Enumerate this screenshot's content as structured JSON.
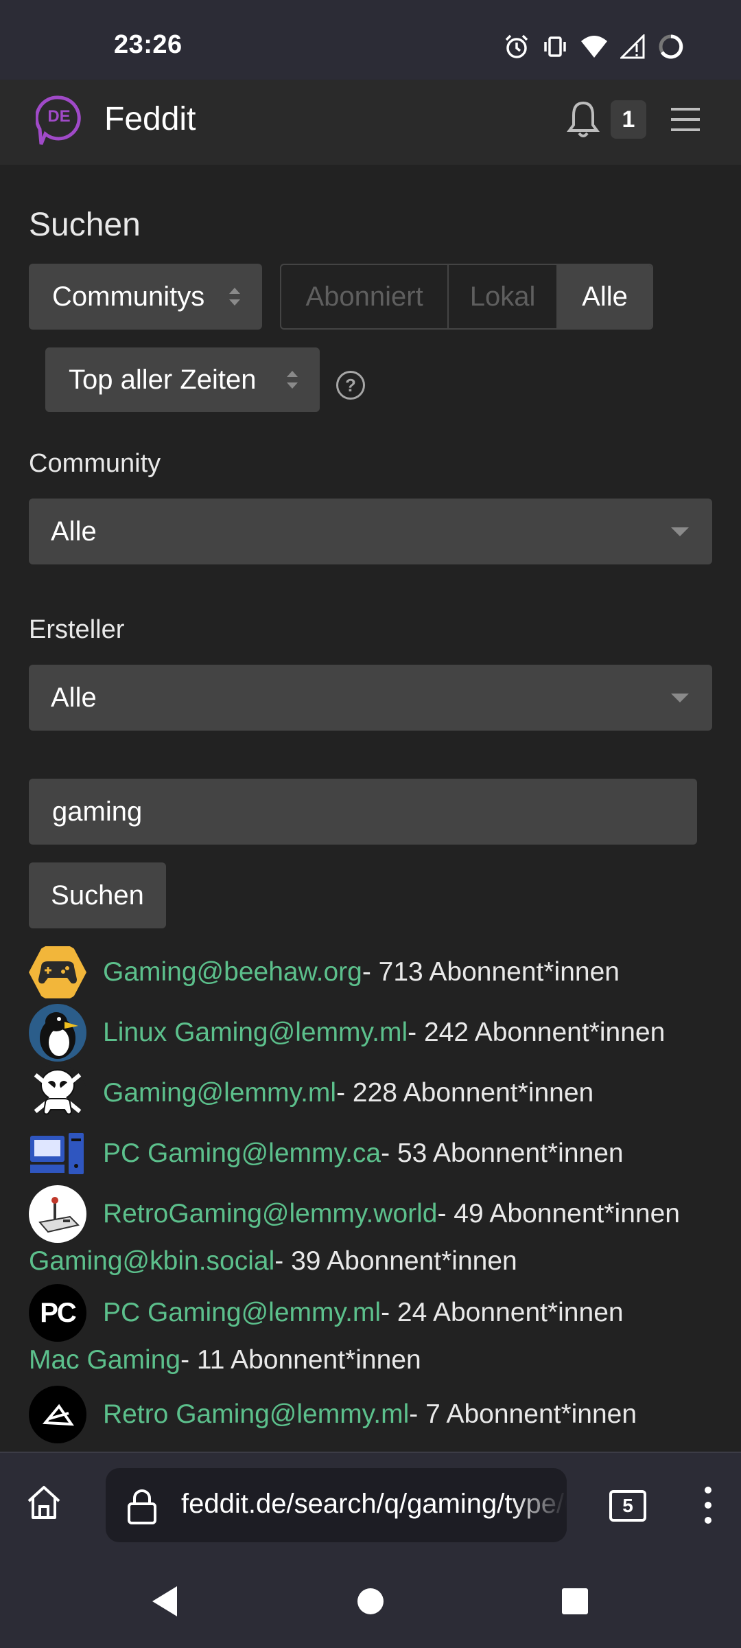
{
  "status_bar": {
    "time": "23:26",
    "icons": [
      "alarm-icon",
      "vibrate-icon",
      "wifi-icon",
      "signal-icon",
      "loading-icon"
    ]
  },
  "header": {
    "logo_text": "DE",
    "brand": "Feddit",
    "notification_count": "1"
  },
  "page": {
    "title": "Suchen"
  },
  "filters": {
    "type_select": "Communitys",
    "listing_tabs": [
      "Abonniert",
      "Lokal",
      "Alle"
    ],
    "listing_selected": "Alle",
    "sort_select": "Top aller Zeiten",
    "help_symbol": "?"
  },
  "community_filter": {
    "label": "Community",
    "value": "Alle"
  },
  "creator_filter": {
    "label": "Ersteller",
    "value": "Alle"
  },
  "search": {
    "query": "gaming",
    "button_label": "Suchen"
  },
  "results": [
    {
      "name": "Gaming@beehaw.org",
      "count": " - 713 Abonnent*innen",
      "has_avatar": true,
      "avatar": "gamepad-icon"
    },
    {
      "name": "Linux Gaming@lemmy.ml",
      "count": " - 242 Abonnent*innen",
      "has_avatar": true,
      "avatar": "penguin-icon"
    },
    {
      "name": "Gaming@lemmy.ml",
      "count": " - 228 Abonnent*innen",
      "has_avatar": true,
      "avatar": "skull-controller-icon"
    },
    {
      "name": "PC Gaming@lemmy.ca",
      "count": " - 53 Abonnent*innen",
      "has_avatar": true,
      "avatar": "computer-icon"
    },
    {
      "name": "RetroGaming@lemmy.world",
      "count": " - 49 Abonnent*innen",
      "has_avatar": true,
      "avatar": "retro-console-icon"
    },
    {
      "name": "Gaming@kbin.social",
      "count": " - 39 Abonnent*innen",
      "has_avatar": false
    },
    {
      "name": "PC Gaming@lemmy.ml",
      "count": " - 24 Abonnent*innen",
      "has_avatar": true,
      "avatar": "pc-letters-icon",
      "avatar_text": "PC"
    },
    {
      "name": "Mac Gaming",
      "count": " - 11 Abonnent*innen",
      "has_avatar": false
    },
    {
      "name": "Retro Gaming@lemmy.ml",
      "count": " - 7 Abonnent*innen",
      "has_avatar": true,
      "avatar": "retro-arrow-icon"
    }
  ],
  "browser": {
    "url": "feddit.de/search/q/gaming/type/Communities",
    "tab_count": "5"
  },
  "colors": {
    "background": "#222222",
    "link": "#5cc08c",
    "control": "#444444",
    "logo_accent": "#a04ac8"
  }
}
